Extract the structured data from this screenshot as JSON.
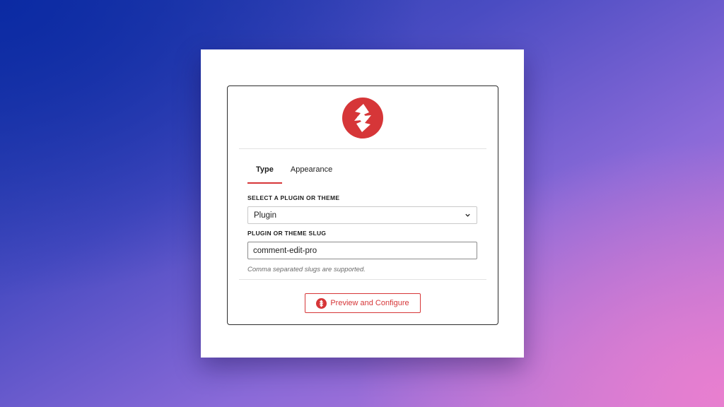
{
  "colors": {
    "accent": "#d63638",
    "text": "#1e1e1e",
    "muted": "#6b6b6b"
  },
  "logo": {
    "icon": "lightning-bolt-logo-icon"
  },
  "tabs": [
    {
      "label": "Type",
      "active": true
    },
    {
      "label": "Appearance",
      "active": false
    }
  ],
  "form": {
    "select_label": "SELECT A PLUGIN OR THEME",
    "select_value": "Plugin",
    "slug_label": "PLUGIN OR THEME SLUG",
    "slug_value": "comment-edit-pro",
    "help_text": "Comma separated slugs are supported."
  },
  "action": {
    "button_label": "Preview and Configure",
    "button_icon": "lightning-bolt-icon"
  }
}
